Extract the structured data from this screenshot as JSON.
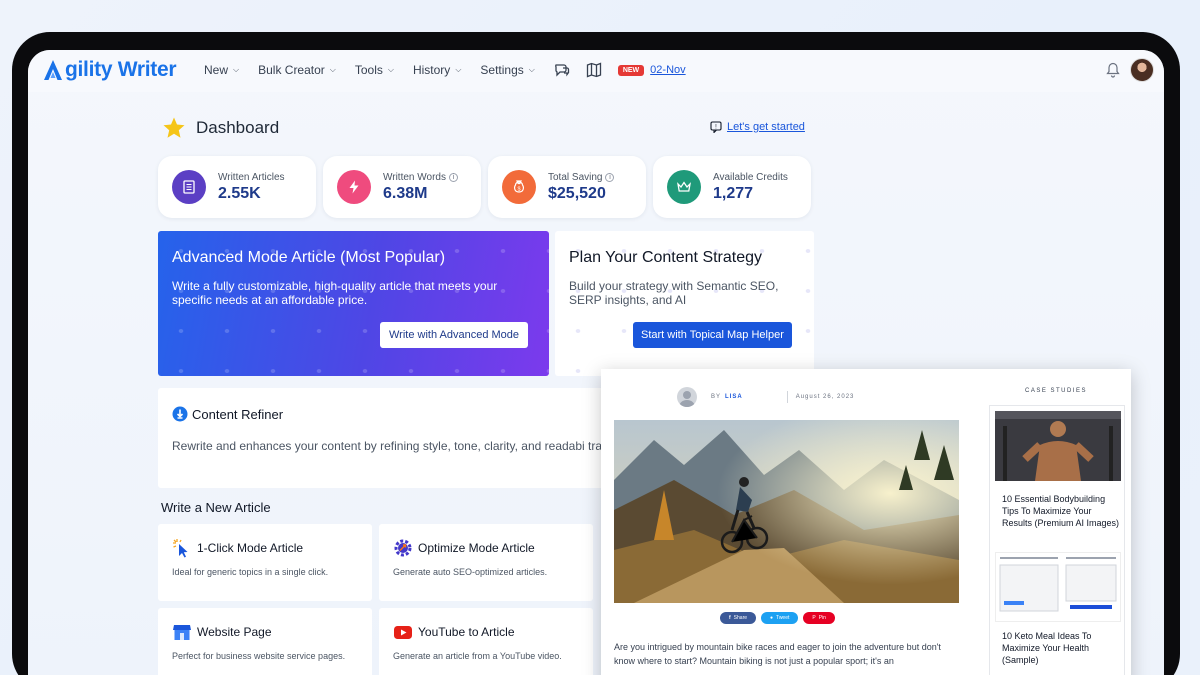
{
  "nav": {
    "logo_text": "gility Writer",
    "items": [
      {
        "label": "New"
      },
      {
        "label": "Bulk Creator"
      },
      {
        "label": "Tools"
      },
      {
        "label": "History"
      },
      {
        "label": "Settings"
      }
    ],
    "new_badge": "NEW",
    "date_link": "02-Nov"
  },
  "dashboard": {
    "title": "Dashboard",
    "get_started": "Let's get started"
  },
  "stats": [
    {
      "label": "Written Articles",
      "value": "2.55K",
      "info": false,
      "color": "#5b3fc4"
    },
    {
      "label": "Written Words",
      "value": "6.38M",
      "info": true,
      "color": "#ef4b7e"
    },
    {
      "label": "Total Saving",
      "value": "$25,520",
      "info": true,
      "color": "#f26b3a"
    },
    {
      "label": "Available Credits",
      "value": "1,277",
      "info": false,
      "color": "#1f9a7a"
    }
  ],
  "advanced": {
    "title": "Advanced Mode Article (Most Popular)",
    "desc": "Write a fully customizable, high-quality article that meets your specific needs at an affordable price.",
    "button": "Write with Advanced Mode"
  },
  "plan": {
    "title": "Plan Your Content Strategy",
    "desc": "Build your strategy with Semantic SEO, SERP insights, and AI",
    "button": "Start with Topical Map Helper"
  },
  "refiner": {
    "title": "Content Refiner",
    "desc": "Rewrite and enhances your content by refining style, tone, clarity, and readabi translating it to suit your audience."
  },
  "write_new": {
    "heading": "Write a New Article",
    "cards": [
      {
        "title": "1-Click Mode Article",
        "desc": "Ideal for generic topics in a single click."
      },
      {
        "title": "Optimize Mode Article",
        "desc": "Generate auto SEO-optimized articles."
      },
      {
        "title": "Website Page",
        "desc": "Perfect for business website service pages."
      },
      {
        "title": "YouTube to Article",
        "desc": "Generate an article from a YouTube video."
      }
    ]
  },
  "blog": {
    "by": "BY",
    "author": "LISA",
    "date": "August 26, 2023",
    "share_labels": [
      "Share",
      "Tweet",
      "Pin"
    ],
    "text": "Are you intrigued by mountain bike races and eager to join the adventure but don't know where to start? Mountain biking is not just a popular sport; it's an",
    "case_studies_label": "CASE STUDIES",
    "case_1": "10 Essential Bodybuilding Tips To Maximize Your Results (Premium AI Images)",
    "case_2": "10 Keto Meal Ideas To Maximize Your Health (Sample)"
  }
}
